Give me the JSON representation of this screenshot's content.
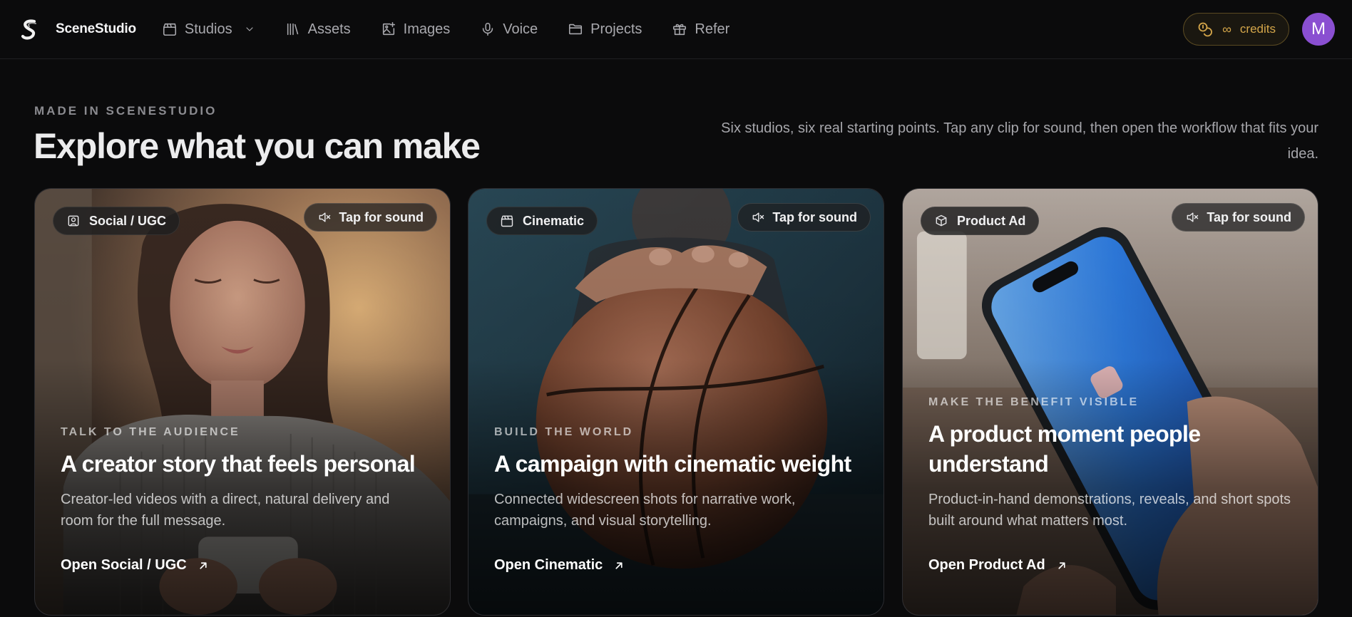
{
  "nav": {
    "brand": "SceneStudio",
    "items": [
      {
        "label": "Studios",
        "icon": "clapperboard-icon",
        "has_dropdown": true
      },
      {
        "label": "Assets",
        "icon": "library-icon"
      },
      {
        "label": "Images",
        "icon": "image-plus-icon"
      },
      {
        "label": "Voice",
        "icon": "microphone-icon"
      },
      {
        "label": "Projects",
        "icon": "folder-icon"
      },
      {
        "label": "Refer",
        "icon": "gift-icon"
      }
    ],
    "credits": {
      "symbol": "∞",
      "label": "credits",
      "icon": "coins-icon"
    },
    "avatar_initial": "M"
  },
  "header": {
    "eyebrow": "MADE IN SCENESTUDIO",
    "title": "Explore what you can make",
    "subtitle": "Six studios, six real starting points. Tap any clip for sound, then open the workflow that fits your idea."
  },
  "cards": [
    {
      "tag": "Social / UGC",
      "tag_icon": "user-square-icon",
      "sound_label": "Tap for sound",
      "eyebrow": "TALK TO THE AUDIENCE",
      "title": "A creator story that feels personal",
      "description": "Creator-led videos with a direct, natural delivery and room for the full message.",
      "link": "Open Social / UGC"
    },
    {
      "tag": "Cinematic",
      "tag_icon": "clapperboard-icon",
      "sound_label": "Tap for sound",
      "eyebrow": "BUILD THE WORLD",
      "title": "A campaign with cinematic weight",
      "description": "Connected widescreen shots for narrative work, campaigns, and visual storytelling.",
      "link": "Open Cinematic"
    },
    {
      "tag": "Product Ad",
      "tag_icon": "box-icon",
      "sound_label": "Tap for sound",
      "eyebrow": "MAKE THE BENEFIT VISIBLE",
      "title": "A product moment people understand",
      "description": "Product-in-hand demonstrations, reveals, and short spots built around what matters most.",
      "link": "Open Product Ad"
    }
  ],
  "colors": {
    "background": "#0b0b0c",
    "credits_accent": "#d4a64a",
    "avatar": "#8a4fd1"
  }
}
